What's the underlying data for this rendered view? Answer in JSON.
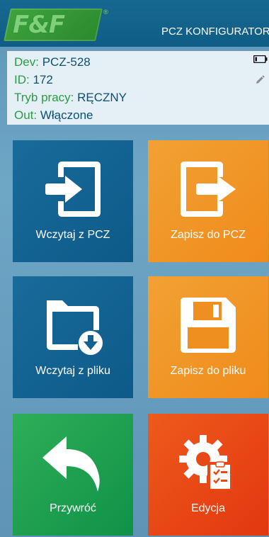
{
  "header": {
    "logo_text": "F&F",
    "logo_mark": "®",
    "title": "PCZ KONFIGURATOR"
  },
  "device": {
    "dev_label": "Dev:",
    "dev_value": "PCZ-528",
    "id_label": "ID:",
    "id_value": "172",
    "mode_label": "Tryb pracy:",
    "mode_value": "RĘCZNY",
    "out_label": "Out:",
    "out_value": "Włączone",
    "battery_icon": "battery-icon",
    "edit_icon": "pencil-icon"
  },
  "tiles": [
    {
      "label": "Wczytaj z PCZ",
      "icon": "import-icon",
      "color": "#126291"
    },
    {
      "label": "Zapisz do PCZ",
      "icon": "export-icon",
      "color": "#f09527"
    },
    {
      "label": "Wczytaj z pliku",
      "icon": "folder-download-icon",
      "color": "#126291"
    },
    {
      "label": "Zapisz do pliku",
      "icon": "floppy-disk-icon",
      "color": "#f09527"
    },
    {
      "label": "Przywróć",
      "icon": "undo-arrow-icon",
      "color": "#16a04e"
    },
    {
      "label": "Edycja",
      "icon": "gear-checklist-icon",
      "color": "#e84716"
    }
  ],
  "colors": {
    "header_bg": "#11608a",
    "background": "#6aa2c4",
    "panel_bg": "#e5eff6",
    "label_green": "#2b9c43",
    "value_blue": "#0c4f73"
  }
}
